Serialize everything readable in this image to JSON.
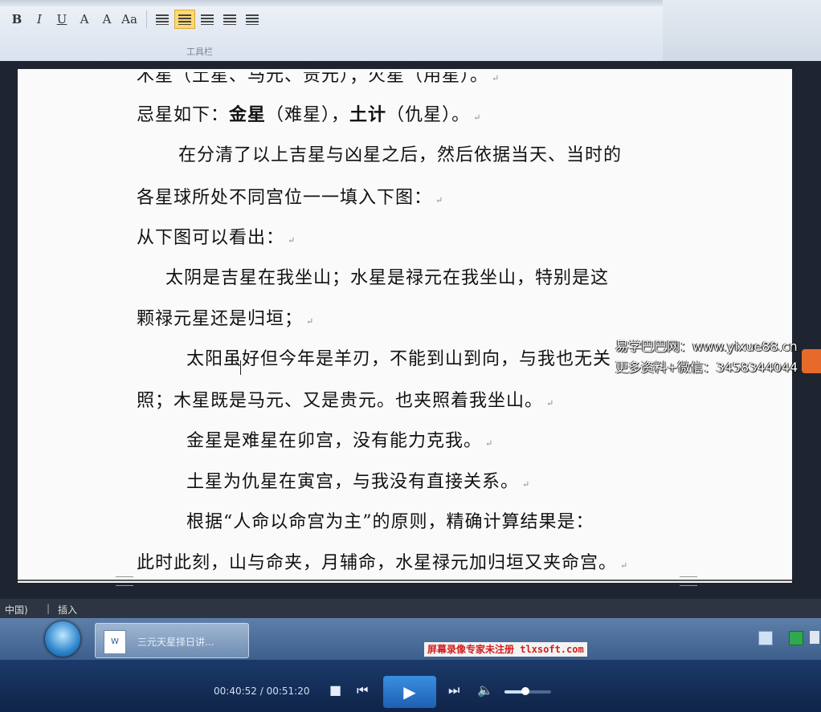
{
  "toolbar": {
    "label": "工具栏",
    "format_buttons": [
      {
        "name": "bold-button",
        "glyph": "B"
      },
      {
        "name": "italic-button",
        "glyph": "I"
      },
      {
        "name": "underline-button",
        "glyph": "U"
      },
      {
        "name": "font-color-box-button",
        "glyph": "A"
      },
      {
        "name": "char-shading-button",
        "glyph": "A"
      },
      {
        "name": "change-case-button",
        "glyph": "Aa"
      }
    ]
  },
  "document": {
    "lines": [
      {
        "text": "木星（土星、马元、贵元）；火星（用星）。"
      },
      {
        "prefix": "忌星如下：",
        "b1": "金星",
        "mid": "（难星），",
        "b2": "土计",
        "suffix": "（仇星）。"
      },
      {
        "text": "在分清了以上吉星与凶星之后，然后依据当天、当时的"
      },
      {
        "text": "各星球所处不同宫位一一填入下图："
      },
      {
        "text": "从下图可以看出："
      },
      {
        "text": "太阴是吉星在我坐山；水星是禄元在我坐山，特别是这"
      },
      {
        "text": "颗禄元星还是归垣；"
      },
      {
        "text": "太阳虽好但今年是羊刃，不能到山到向，与我也无关"
      },
      {
        "text": "照；木星既是马元、又是贵元。也夹照着我坐山。"
      },
      {
        "text": "金星是难星在卯宫，没有能力克我。"
      },
      {
        "text": "土星为仇星在寅宫，与我没有直接关系。"
      },
      {
        "text": "根据“人命以命宫为主”的原则，精确计算结果是："
      },
      {
        "text": "此时此刻，山与命夹，月辅命，水星禄元加归垣又夹命宫。"
      }
    ],
    "paragraph_mark": "↵"
  },
  "watermark": {
    "line1": "易学巴巴网：www.yixue88.cn",
    "line2": "更多资料+微信：3458344044"
  },
  "statusbar": {
    "language": "中国)",
    "mode": "插入"
  },
  "taskbar": {
    "task_title": "三元天星择日讲...",
    "rec_banner": "屏幕录像专家未注册 tlxsoft.com"
  },
  "player": {
    "current_time": "00:40:52",
    "total_time": "00:51:20",
    "separator": " / ",
    "volume": 0.45
  }
}
